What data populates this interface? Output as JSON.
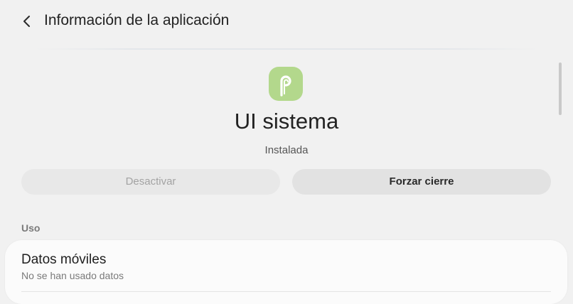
{
  "header": {
    "title": "Información de la aplicación",
    "back_icon": "back-arrow-icon"
  },
  "app": {
    "name": "UI sistema",
    "status": "Instalada",
    "icon": "android-p-icon",
    "icon_color": "#b3d88c"
  },
  "actions": {
    "disable_label": "Desactivar",
    "force_stop_label": "Forzar cierre"
  },
  "usage": {
    "section_label": "Uso",
    "items": [
      {
        "title": "Datos móviles",
        "subtitle": "No se han usado datos"
      }
    ]
  }
}
